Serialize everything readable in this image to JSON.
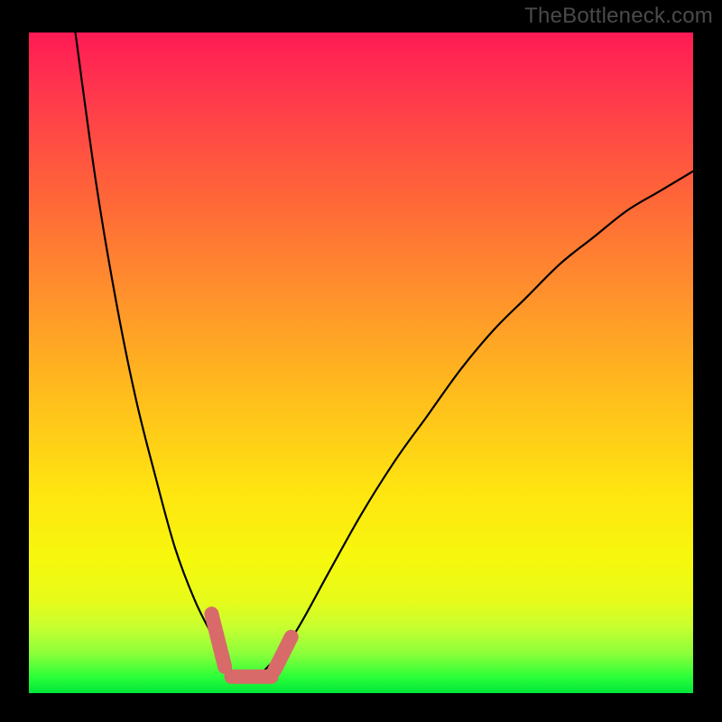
{
  "watermark": "TheBottleneck.com",
  "chart_data": {
    "type": "line",
    "title": "",
    "xlabel": "",
    "ylabel": "",
    "xlim": [
      0,
      100
    ],
    "ylim": [
      0,
      100
    ],
    "gradient_stops": [
      {
        "pos": 0,
        "color": "#ff1a55"
      },
      {
        "pos": 25,
        "color": "#ff6638"
      },
      {
        "pos": 52,
        "color": "#ffb51f"
      },
      {
        "pos": 80,
        "color": "#f6f80e"
      },
      {
        "pos": 94,
        "color": "#8cff3a"
      },
      {
        "pos": 100,
        "color": "#00e63b"
      }
    ],
    "series": [
      {
        "name": "bottleneck-curve",
        "note": "V-shaped curve; y is percentage from top (0=top, 100=bottom). Minimum (best) around x≈33.",
        "x": [
          7,
          10,
          13,
          16,
          19,
          22,
          25,
          28,
          30,
          33,
          36,
          40,
          45,
          50,
          55,
          60,
          65,
          70,
          75,
          80,
          85,
          90,
          95,
          100
        ],
        "y": [
          0,
          22,
          40,
          55,
          67,
          78,
          86,
          92,
          96,
          98,
          96,
          91,
          82,
          73,
          65,
          58,
          51,
          45,
          40,
          35,
          31,
          27,
          24,
          21
        ]
      }
    ],
    "highlight": {
      "name": "bottom-markers",
      "color": "#d86a6a",
      "note": "pink rounded segments near the minimum of the curve",
      "segments": [
        {
          "x0": 27.5,
          "y0": 88,
          "x1": 29.5,
          "y1": 96
        },
        {
          "x0": 30.5,
          "y0": 97.5,
          "x1": 36.5,
          "y1": 97.5
        },
        {
          "x0": 37.0,
          "y0": 96.5,
          "x1": 39.5,
          "y1": 91.5
        }
      ]
    }
  }
}
